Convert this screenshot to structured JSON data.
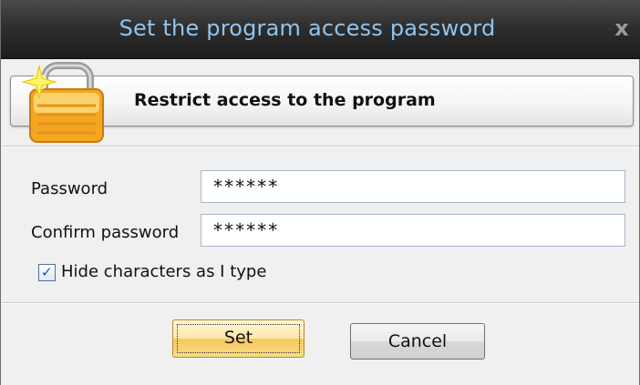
{
  "window": {
    "title": "Set the program access password",
    "close_glyph": "x"
  },
  "header": {
    "text": "Restrict access to the program",
    "icon": "lock-icon"
  },
  "form": {
    "password_label": "Password",
    "password_value": "******",
    "confirm_label": "Confirm password",
    "confirm_value": "******",
    "hide_chars_label": "Hide characters as I type",
    "hide_chars_checked": true
  },
  "buttons": {
    "set_label": "Set",
    "cancel_label": "Cancel"
  },
  "colors": {
    "title_text": "#8fc4ee",
    "titlebar": "#2f2f2f",
    "set_button": "#f6c75a"
  }
}
